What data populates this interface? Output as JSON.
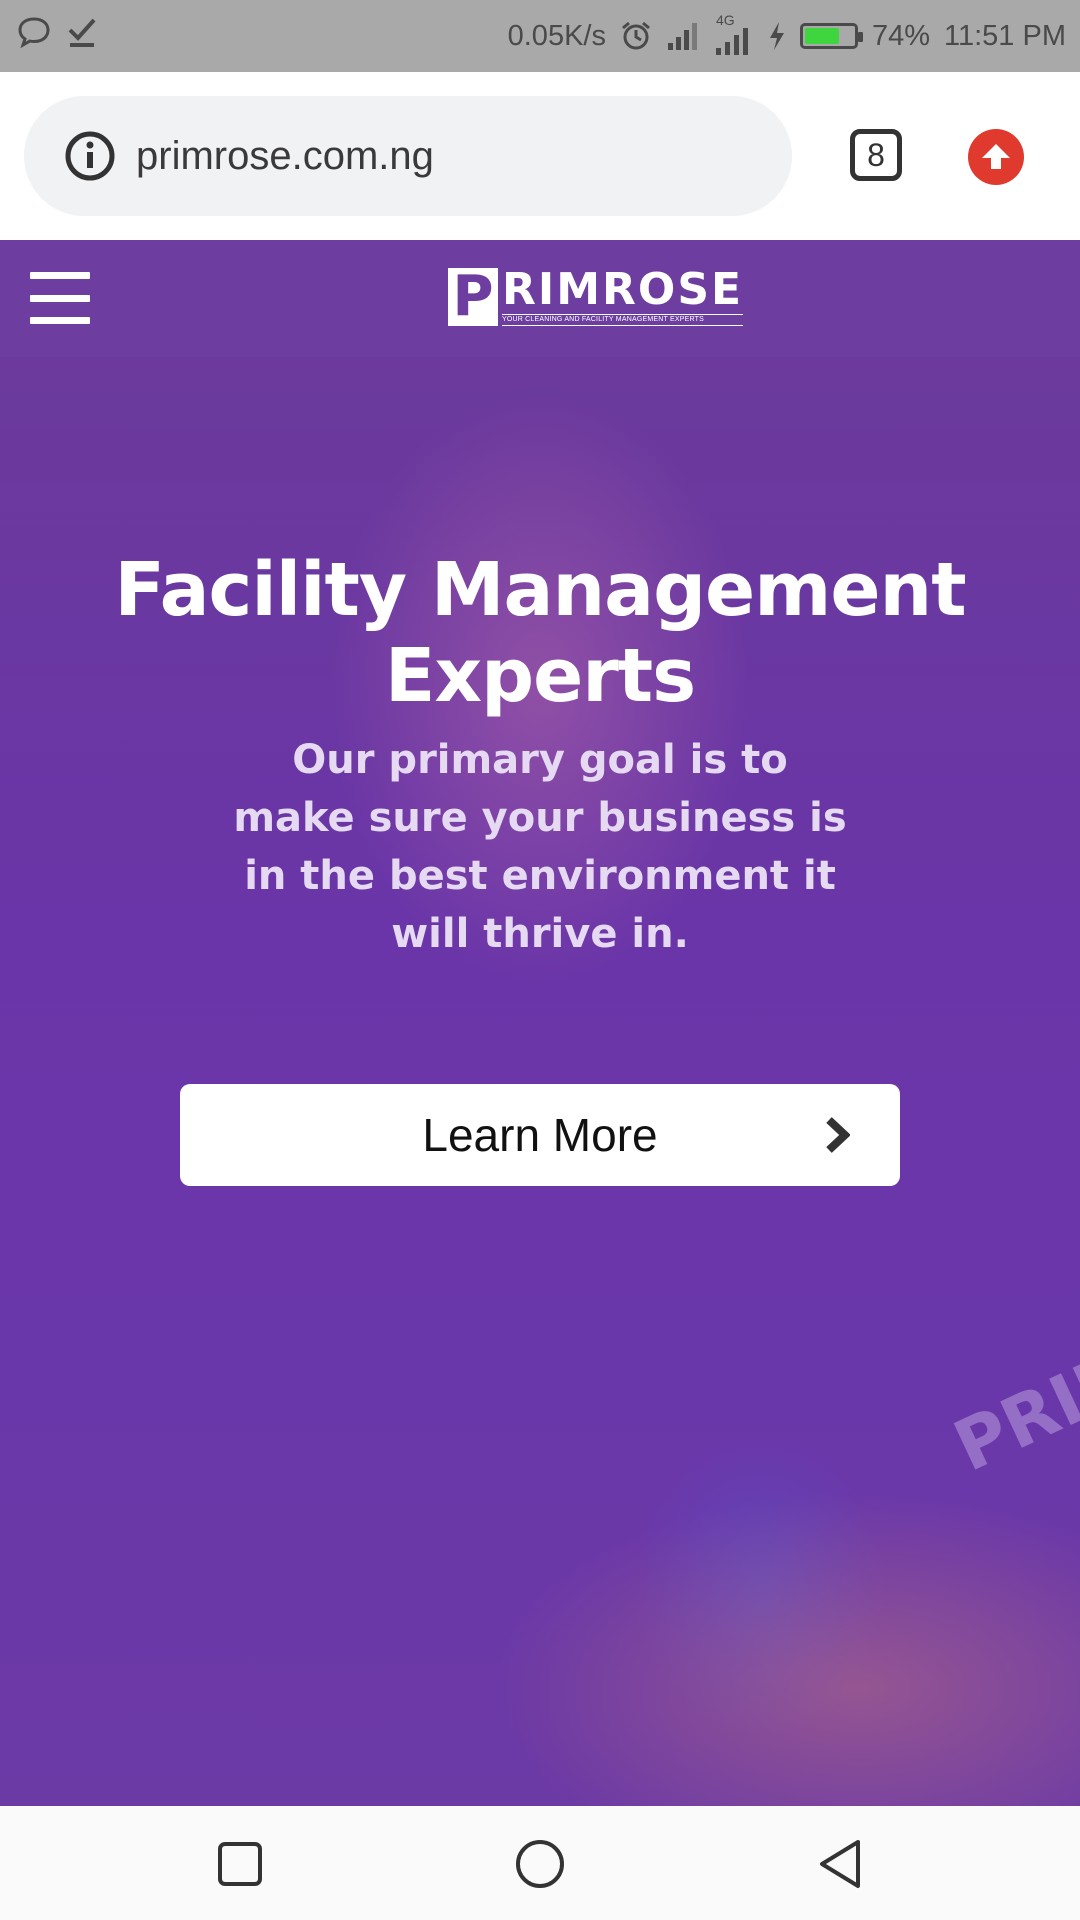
{
  "status_bar": {
    "net_speed": "0.05K/s",
    "network_type": "4G",
    "battery_percent": "74%",
    "battery_level": 0.74,
    "time": "11:51 PM",
    "icons": [
      "chat-bubble-icon",
      "download-done-icon",
      "alarm-icon",
      "signal-icon",
      "signal-4g-icon",
      "charging-icon",
      "battery-icon"
    ]
  },
  "browser": {
    "url": "primrose.com.ng",
    "tab_count": "8",
    "icons": [
      "info-icon",
      "tabs-icon",
      "update-arrow-icon"
    ]
  },
  "site_header": {
    "logo_letter": "P",
    "logo_word": "RIMROSE",
    "logo_tagline": "YOUR CLEANING AND FACILITY MANAGEMENT EXPERTS"
  },
  "hero": {
    "title": "Facility Management Experts",
    "subtitle": "Our primary goal is to make sure your business is in the best environment it will thrive in.",
    "cta_label": "Learn More",
    "watermark": "PRIM"
  },
  "colors": {
    "brand_purple": "#6d3ea0",
    "status_bar_bg": "#a9a9a9",
    "update_red": "#e0392e",
    "battery_green": "#3ed53e"
  },
  "nav_bar": {
    "icons": [
      "recent-apps-icon",
      "home-icon",
      "back-icon"
    ]
  }
}
